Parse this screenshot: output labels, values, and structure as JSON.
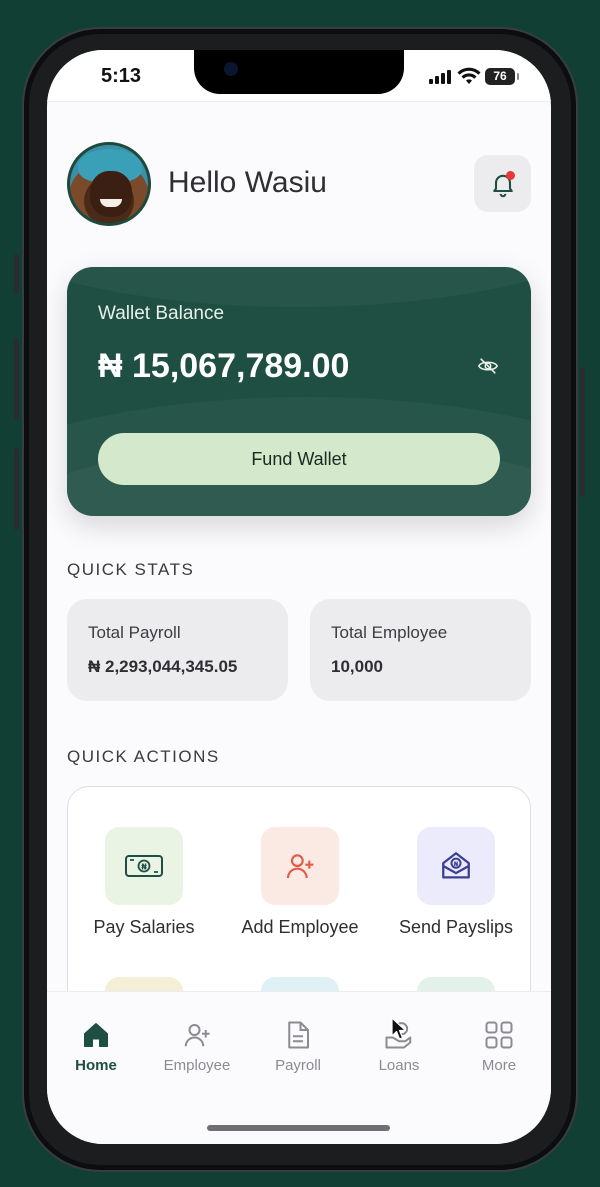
{
  "status_bar": {
    "time": "5:13",
    "battery": "76"
  },
  "header": {
    "greeting": "Hello Wasiu",
    "avatar_icon": "user-avatar",
    "bell_icon": "bell-icon",
    "notification_dot_color": "#e53935"
  },
  "wallet": {
    "label": "Wallet Balance",
    "amount": "₦ 15,067,789.00",
    "visibility_icon": "eye-off-icon",
    "fund_button_label": "Fund Wallet",
    "card_color": "#1f4f42",
    "button_color": "#d4e8cc"
  },
  "quick_stats": {
    "title": "QUICK STATS",
    "items": [
      {
        "label": "Total Payroll",
        "value": "₦ 2,293,044,345.05"
      },
      {
        "label": "Total Employee",
        "value": "10,000"
      }
    ]
  },
  "quick_actions": {
    "title": "QUICK ACTIONS",
    "items": [
      {
        "label": "Pay Salaries",
        "icon": "cash-icon",
        "tile_color": "#e9f4e5"
      },
      {
        "label": "Add Employee",
        "icon": "add-user-icon",
        "tile_color": "#fbe9e4"
      },
      {
        "label": "Send Payslips",
        "icon": "payslip-envelope-icon",
        "tile_color": "#ebebfb"
      }
    ]
  },
  "tab_bar": {
    "tabs": [
      {
        "label": "Home",
        "icon": "home-icon",
        "active": true
      },
      {
        "label": "Employee",
        "icon": "add-user-icon",
        "active": false
      },
      {
        "label": "Payroll",
        "icon": "document-icon",
        "active": false
      },
      {
        "label": "Loans",
        "icon": "loan-hand-icon",
        "active": false
      },
      {
        "label": "More",
        "icon": "grid-icon",
        "active": false
      }
    ]
  }
}
